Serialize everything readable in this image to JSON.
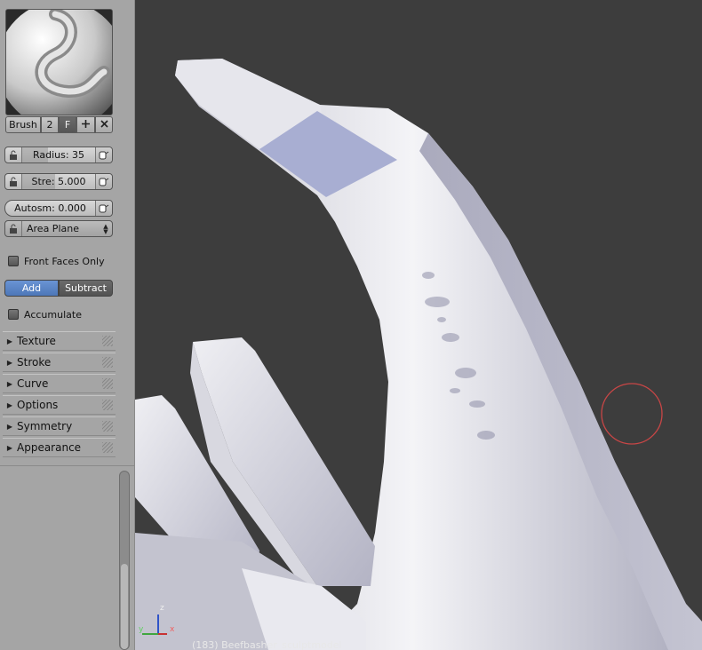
{
  "panel": {
    "brush_label": "Brush",
    "brush_users": "2",
    "fake_user": "F",
    "radius_label": "Radius: 35",
    "strength_label": "Stre: 5.000",
    "autosmooth_label": "Autosm: 0.000",
    "plane_label": "Area Plane",
    "front_faces_label": "Front Faces Only",
    "add_label": "Add",
    "subtract_label": "Subtract",
    "accumulate_label": "Accumulate",
    "sections": [
      "Texture",
      "Stroke",
      "Curve",
      "Options",
      "Symmetry",
      "Appearance"
    ],
    "radius_fill": 0.35,
    "strength_fill": 0.45,
    "active_mode": "Add"
  },
  "viewport": {
    "object_label": "(183) Beefbasher_sculptmodel",
    "axis_x": "x",
    "axis_y": "y",
    "axis_z": "z"
  },
  "colors": {
    "panel_bg": "#a5a5a5",
    "viewport_bg": "#3d3d3d",
    "active_toggle": "#5a86c8",
    "brush_cursor": "#c84646",
    "mesh": "#d8d8e4"
  },
  "icons": [
    "brush-preview",
    "lock-icon",
    "pen-pressure-icon",
    "add-icon",
    "unlink-icon",
    "dropdown-arrows-icon",
    "disclosure-triangle-icon",
    "grip-icon",
    "axis-gizmo"
  ]
}
